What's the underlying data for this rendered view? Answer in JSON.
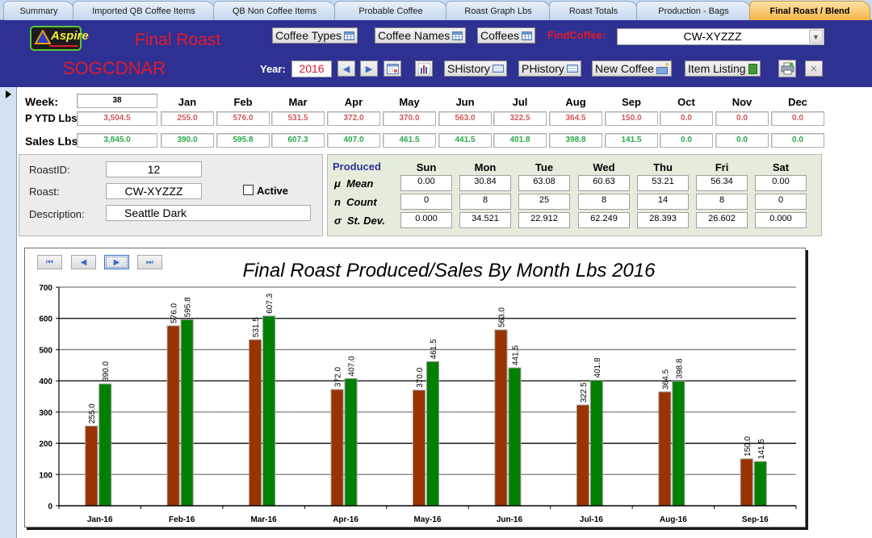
{
  "tabs": [
    {
      "label": "Summary",
      "active": false
    },
    {
      "label": "Imported QB Coffee Items",
      "active": false
    },
    {
      "label": "QB Non Coffee Items",
      "active": false
    },
    {
      "label": "Probable Coffee",
      "active": false
    },
    {
      "label": "Roast Graph Lbs",
      "active": false
    },
    {
      "label": "Roast Totals",
      "active": false
    },
    {
      "label": "Production - Bags",
      "active": false
    },
    {
      "label": "Final Roast / Blend",
      "active": true
    }
  ],
  "header": {
    "logo_text": "Aspire",
    "title": "Final Roast",
    "subtitle": "SOGCDNAR",
    "buttons": {
      "coffee_types": "Coffee Types",
      "coffee_names": "Coffee Names",
      "coffees": "Coffees",
      "shistory": "SHistory",
      "phistory": "PHistory",
      "new_coffee": "New Coffee",
      "item_listing": "Item Listing"
    },
    "find_label": "FindCoffee:",
    "find_value": "CW-XYZZZ",
    "year_label": "Year:",
    "year_value": "2016",
    "icons": {
      "prev": "◆",
      "next": "◆",
      "calendar": "calendar-icon",
      "chart": "chart-icon",
      "print": "printer-icon",
      "close": "✕"
    }
  },
  "month_grid": {
    "week_label": "Week:",
    "week_value": "38",
    "months": [
      "Jan",
      "Feb",
      "Mar",
      "Apr",
      "May",
      "Jun",
      "Jul",
      "Aug",
      "Sep",
      "Oct",
      "Nov",
      "Dec"
    ],
    "produced": {
      "label": "P YTD Lbs",
      "total": "3,504.5",
      "values": [
        "255.0",
        "576.0",
        "531.5",
        "372.0",
        "370.0",
        "563.0",
        "322.5",
        "364.5",
        "150.0",
        "0.0",
        "0.0",
        "0.0"
      ]
    },
    "sales": {
      "label": "Sales Lbs",
      "total": "3,845.0",
      "values": [
        "390.0",
        "595.8",
        "607.3",
        "407.0",
        "461.5",
        "441.5",
        "401.8",
        "398.8",
        "141.5",
        "0.0",
        "0.0",
        "0.0"
      ]
    }
  },
  "roast": {
    "roast_id_label": "RoastID:",
    "roast_id": "12",
    "roast_label": "Roast:",
    "roast": "CW-XYZZZ",
    "active_label": "Active",
    "active": false,
    "description_label": "Description:",
    "description": "Seattle Dark"
  },
  "stats": {
    "title": "Produced",
    "days": [
      "Sun",
      "Mon",
      "Tue",
      "Wed",
      "Thu",
      "Fri",
      "Sat"
    ],
    "rows": [
      {
        "label": "μ  Mean",
        "values": [
          "0.00",
          "30.84",
          "63.08",
          "60.63",
          "53.21",
          "56.34",
          "0.00"
        ]
      },
      {
        "label": "n  Count",
        "values": [
          "0",
          "8",
          "25",
          "8",
          "14",
          "8",
          "0"
        ]
      },
      {
        "label": "σ  St. Dev.",
        "values": [
          "0.000",
          "34.521",
          "22.912",
          "62.249",
          "28.393",
          "26.602",
          "0.000"
        ]
      }
    ]
  },
  "chart_nav": {
    "first": "first-record-icon",
    "prev": "previous-record-icon",
    "next": "next-record-icon",
    "last": "last-record-icon"
  },
  "chart_data": {
    "type": "bar",
    "title": "Final Roast Produced/Sales By Month Lbs 2016",
    "xlabel": "",
    "ylabel": "",
    "categories": [
      "Jan-16",
      "Feb-16",
      "Mar-16",
      "Apr-16",
      "May-16",
      "Jun-16",
      "Jul-16",
      "Aug-16",
      "Sep-16"
    ],
    "series": [
      {
        "name": "Produced",
        "color": "#993300",
        "values": [
          255.0,
          576.0,
          531.5,
          372.0,
          370.0,
          563.0,
          322.5,
          364.5,
          150.0
        ]
      },
      {
        "name": "Sales",
        "color": "#008000",
        "values": [
          390.0,
          595.8,
          607.3,
          407.0,
          461.5,
          441.5,
          401.8,
          398.8,
          141.5
        ]
      }
    ],
    "ylim": [
      0,
      700
    ],
    "yticks": [
      0,
      100,
      200,
      300,
      400,
      500,
      600,
      700
    ],
    "grid": true,
    "legend": "none",
    "data_labels": true
  },
  "colors": {
    "header_bg": "#2e3192",
    "accent_red": "#e3192b",
    "active_tab": "#f6b445",
    "produced_text": "#d2585a",
    "sales_text": "#2ba84a"
  }
}
